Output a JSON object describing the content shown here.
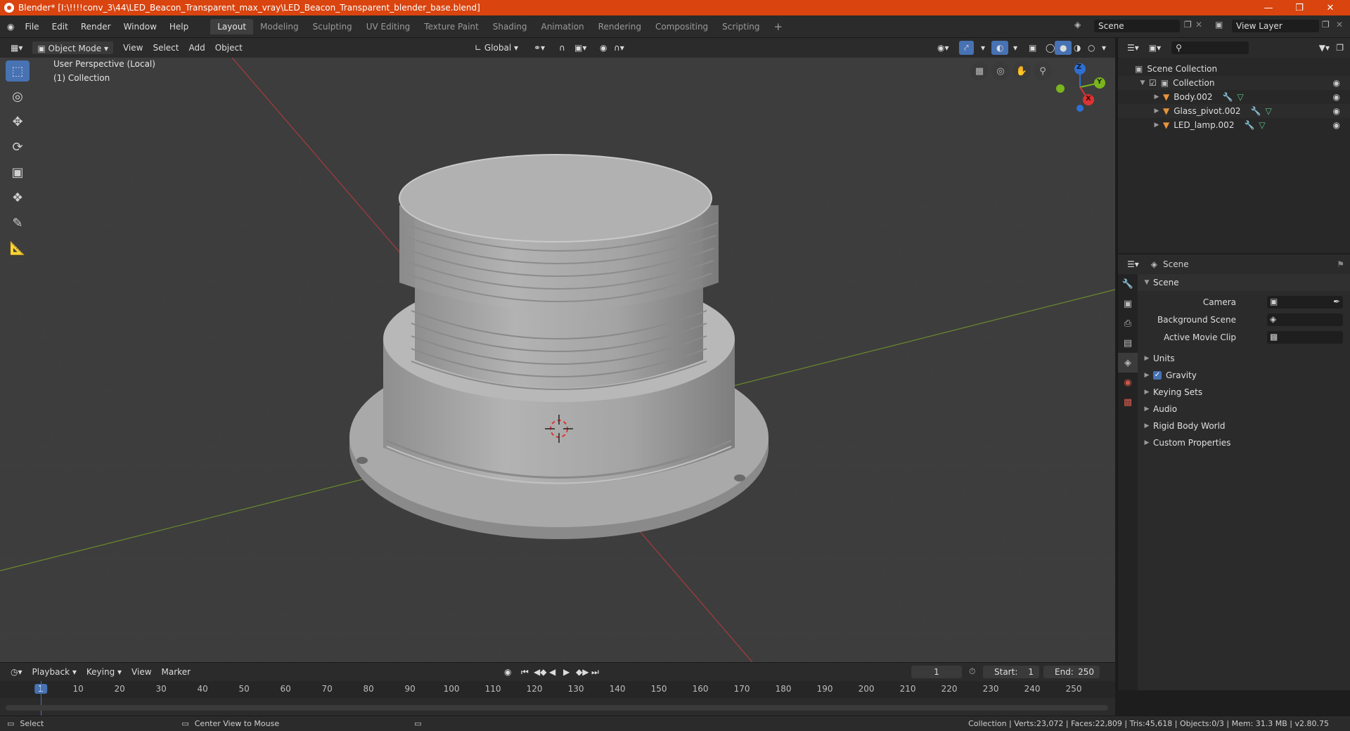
{
  "window": {
    "title": "Blender* [I:\\!!!!conv_3\\44\\LED_Beacon_Transparent_max_vray\\LED_Beacon_Transparent_blender_base.blend]"
  },
  "menu": [
    "File",
    "Edit",
    "Render",
    "Window",
    "Help"
  ],
  "workspaces": [
    "Layout",
    "Modeling",
    "Sculpting",
    "UV Editing",
    "Texture Paint",
    "Shading",
    "Animation",
    "Rendering",
    "Compositing",
    "Scripting"
  ],
  "active_workspace": "Layout",
  "scene_field": "Scene",
  "view_layer_field": "View Layer",
  "viewport_header": {
    "mode": "Object Mode",
    "view": "View",
    "select": "Select",
    "add": "Add",
    "object": "Object",
    "orientation": "Global"
  },
  "viewport": {
    "perspective": "User Perspective (Local)",
    "collection": "(1) Collection",
    "gizmo": {
      "x": "X",
      "y": "Y",
      "z": "Z"
    }
  },
  "outliner": {
    "root": "Scene Collection",
    "collection": "Collection",
    "objects": [
      "Body.002",
      "Glass_pivot.002",
      "LED_lamp.002"
    ]
  },
  "properties": {
    "header": "Scene",
    "panel": "Scene",
    "camera_label": "Camera",
    "background_scene_label": "Background Scene",
    "movie_clip_label": "Active Movie Clip",
    "subpanels": [
      "Units",
      "Gravity",
      "Keying Sets",
      "Audio",
      "Rigid Body World",
      "Custom Properties"
    ]
  },
  "timeline": {
    "playback": "Playback",
    "keying": "Keying",
    "view": "View",
    "marker": "Marker",
    "current_frame": "1",
    "start_label": "Start:",
    "start": "1",
    "end_label": "End:",
    "end": "250",
    "ticks": [
      "1",
      "10",
      "20",
      "30",
      "40",
      "50",
      "60",
      "70",
      "80",
      "90",
      "100",
      "110",
      "120",
      "130",
      "140",
      "150",
      "160",
      "170",
      "180",
      "190",
      "200",
      "210",
      "220",
      "230",
      "240",
      "250"
    ]
  },
  "status": {
    "left": "Select",
    "middle": "Center View to Mouse",
    "right": "Collection | Verts:23,072 | Faces:22,809 | Tris:45,618 | Objects:0/3 | Mem: 31.3 MB | v2.80.75"
  }
}
